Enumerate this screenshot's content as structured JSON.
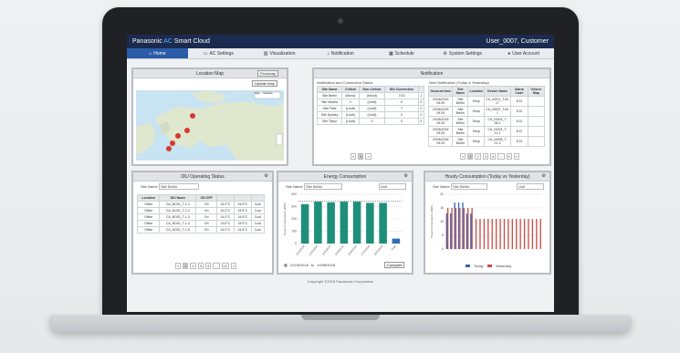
{
  "app": {
    "brand_a": "Panasonic ",
    "brand_b": "AC",
    "brand_c": " Smart Cloud",
    "user": "User_0007, Customer"
  },
  "nav": [
    {
      "label": "Home",
      "icon": "home-icon"
    },
    {
      "label": "AC Settings",
      "icon": "ac-icon"
    },
    {
      "label": "Visualization",
      "icon": "chart-icon"
    },
    {
      "label": "Notification",
      "icon": "bell-icon"
    },
    {
      "label": "Schedule",
      "icon": "calendar-icon"
    },
    {
      "label": "System Settings",
      "icon": "gear-icon"
    },
    {
      "label": "User Account",
      "icon": "user-icon"
    }
  ],
  "location_map": {
    "title": "Location Map",
    "floormap_btn": "Floormap",
    "update_btn": "Update map",
    "view_map": "Map",
    "view_satellite": "Satellite"
  },
  "notification": {
    "title": "Notification",
    "status_title": "Notification and Connection Status",
    "history_title": "New Notification (Today & Yesterday)",
    "status_headers": [
      "Site Name",
      "Critical",
      "Non-Critical",
      "IDU Connection"
    ],
    "status_rows": [
      [
        "Site Berlin",
        "(Mond)",
        "(Mond)",
        "7/13",
        "1"
      ],
      [
        "Site Madrid",
        "0",
        "(Lindt)",
        "0",
        "0"
      ],
      [
        "Site Paris",
        "(Lindt)",
        "(Lindt)",
        "7",
        "0"
      ],
      [
        "Site Sydney",
        "(Lindt)",
        "(Lindt)",
        "0",
        "0"
      ],
      [
        "Site Tokyo",
        "(Lindt)",
        "0",
        "0",
        "0"
      ]
    ],
    "history_headers": [
      "Occured time",
      "Site Name",
      "Location",
      "Device Name",
      "Alarm Code",
      "View in Map"
    ],
    "history_rows": [
      [
        "20/06/2018 09:25",
        "Site Berlin",
        "Shop",
        "CA_NO01_T-W-17",
        "E13",
        ""
      ],
      [
        "20/06/2018 09:25",
        "Site Berlin",
        "Shop",
        "CA_NO02_T-W-1",
        "E13",
        ""
      ],
      [
        "20/06/2018 09:25",
        "Site Berlin",
        "Shop",
        "CA_NO03_T-28-1",
        "E13",
        ""
      ],
      [
        "20/06/2018 09:25",
        "Site Berlin",
        "Shop",
        "CA_NO04_T-21-1",
        "E13",
        ""
      ],
      [
        "20/06/2018 09:25",
        "Site Berlin",
        "Shop",
        "CA_NO05_T-21-3",
        "E13",
        ""
      ]
    ],
    "pager_left": [
      "«",
      "1",
      "»"
    ],
    "pager_right": [
      "«",
      "1",
      "2",
      "3",
      "4",
      "...",
      "9",
      "»"
    ]
  },
  "idu": {
    "title": "IDU Operating Status",
    "site_label": "Site Name",
    "site_value": "Site Berlin",
    "headers": [
      "Location",
      "IDU Name",
      "ON OFF",
      "",
      "",
      ""
    ],
    "rows": [
      [
        "Office",
        "CA_NO01_T-1-1",
        "On",
        "24.0°C",
        "24.5°C",
        "Cool"
      ],
      [
        "Office",
        "CA_NO01_T-1-2",
        "On",
        "24.0°C",
        "24.5°C",
        "Cool"
      ],
      [
        "Office",
        "CA_NO01_T-1-3",
        "On",
        "24.0°C",
        "24.5°C",
        "Cool"
      ],
      [
        "Office",
        "CA_NO01_T-1-4",
        "On",
        "23.0°C",
        "23.5°C",
        "Cool"
      ],
      [
        "Office",
        "CA_NO01_T-1-5",
        "On",
        "24.0°C",
        "24.5°C",
        "Cool"
      ]
    ],
    "pager": [
      "«",
      "1",
      "2",
      "3",
      "4",
      "...",
      "12",
      "»"
    ]
  },
  "energy": {
    "title": "Energy Consumption",
    "site_label": "Site Name",
    "site_value": "Site Berlin",
    "unit_label": "Unit",
    "date_from": "12/06/2018",
    "to": "to",
    "date_to": "19/06/2018",
    "compare_btn": "Compare"
  },
  "hourly": {
    "title": "Hourly Consumption (Today vs Yesterday)",
    "site_label": "Site Name",
    "site_value": "Site Berlin",
    "unit_label": "Unit",
    "legend_today": "Today",
    "legend_yesterday": "Yesterday"
  },
  "footer": "Copyright ©2018 Panasonic Corporation",
  "chart_data": [
    {
      "type": "bar",
      "title": "Energy Consumption",
      "ylabel": "Power Consumption (kWh)",
      "categories": [
        "12/6/2018",
        "13/6/2018",
        "14/6/2018",
        "15/6/2018",
        "16/6/2018",
        "17/6/2018",
        "18/6/2018",
        "Total"
      ],
      "values": [
        320,
        340,
        335,
        340,
        340,
        330,
        330,
        40
      ],
      "ylim": [
        0,
        400
      ],
      "colors": {
        "bars": "#1f8f7a",
        "total": "#2a6fb5"
      }
    },
    {
      "type": "bar",
      "title": "Hourly Consumption (Today vs Yesterday)",
      "ylabel": "Power Consumption (kWh)",
      "ylim": [
        0,
        20
      ],
      "series": [
        {
          "name": "Today",
          "color": "#3a66b0",
          "values": [
            13,
            13,
            17,
            17,
            17,
            13,
            13,
            0,
            0,
            0,
            0,
            0,
            0,
            0,
            0,
            0,
            0,
            0,
            0,
            0,
            0,
            0,
            0,
            0
          ]
        },
        {
          "name": "Yesterday",
          "color": "#c94f45",
          "values": [
            15,
            15,
            15,
            15,
            15,
            15,
            15,
            11,
            11,
            11,
            11,
            11,
            11,
            11,
            11,
            11,
            11,
            11,
            11,
            11,
            11,
            11,
            11,
            11
          ]
        }
      ]
    }
  ]
}
